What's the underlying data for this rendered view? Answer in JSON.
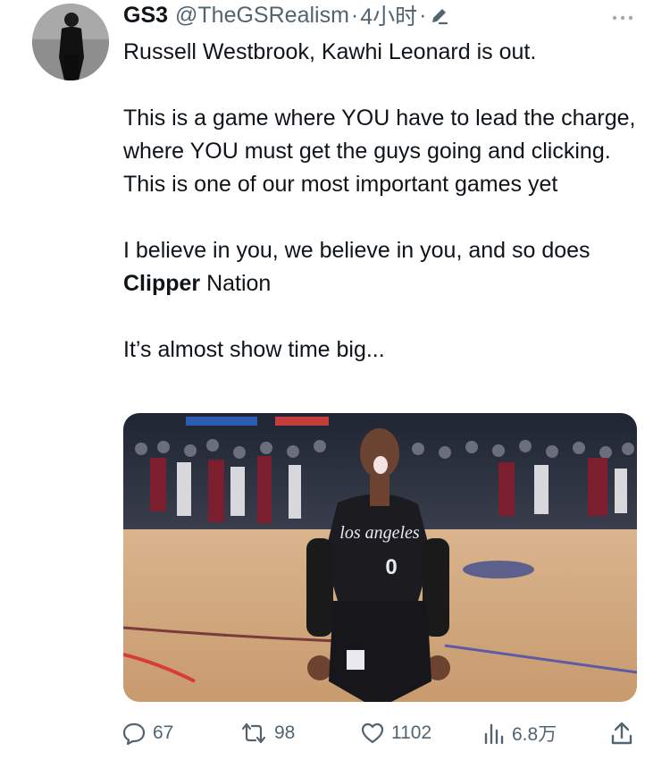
{
  "author": {
    "name": "GS3",
    "handle": "@TheGSRealism",
    "separator": "·",
    "time": "4小时",
    "avatar_icon": "avatar-silhouette-icon",
    "edited_icon": "pencil-icon",
    "more_icon": "more-dots-icon"
  },
  "tweet": {
    "line1": "Russell Westbrook, Kawhi Leonard is out.",
    "para2": "This is a game where YOU have to lead the charge, where YOU must get the guys going and clicking. This is one of our most important games yet",
    "para3_start": "I believe in you, we believe in you, and so does ",
    "para3_bold": "Clipper",
    "para3_end": " Nation",
    "para4": "It’s almost show time big..."
  },
  "media": {
    "jersey_city": "los angeles",
    "jersey_number": "0"
  },
  "actions": {
    "reply": {
      "icon": "reply-icon",
      "count": "67"
    },
    "retweet": {
      "icon": "retweet-icon",
      "count": "98"
    },
    "like": {
      "icon": "heart-icon",
      "count": "1102"
    },
    "views": {
      "icon": "views-chart-icon",
      "count": "6.8万"
    },
    "share": {
      "icon": "share-icon"
    }
  },
  "colors": {
    "text_primary": "#0f1419",
    "text_secondary": "#536471",
    "jersey": "#1b1b20"
  }
}
